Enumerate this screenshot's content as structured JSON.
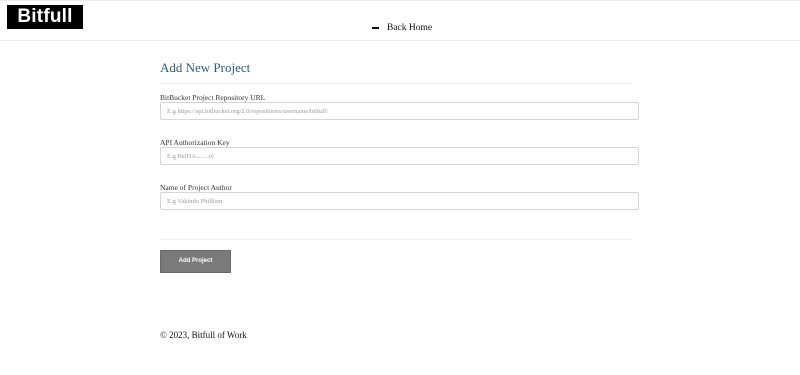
{
  "header": {
    "logo_text": "Bitfull",
    "back_home_label": "Back Home"
  },
  "main": {
    "title": "Add New Project",
    "fields": [
      {
        "label": "BitBucket Project Repository URL",
        "value": "",
        "placeholder": "E.g https://api.bitbucket.org/2.0/repositories/username/bitfull/"
      },
      {
        "label": "API Authorization Key",
        "value": "",
        "placeholder": "E.g BelHA........tv"
      },
      {
        "label": "Name of Project Author",
        "value": "",
        "placeholder": "E.g Vakindu Phillism"
      }
    ],
    "submit_label": "Add Project"
  },
  "footer": {
    "text": "© 2023, Bitfull of Work"
  },
  "colors": {
    "title": "#2a5a8e",
    "button": "#7a7a7a",
    "logo_bg": "#000000"
  },
  "icons": {
    "back_home": "minus-icon"
  }
}
